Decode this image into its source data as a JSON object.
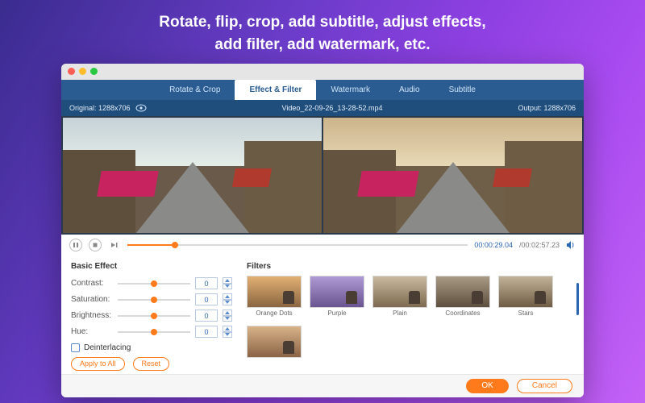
{
  "headline_line1": "Rotate, flip, crop, add subtitle, adjust effects,",
  "headline_line2": "add filter, add watermark, etc.",
  "tabs": {
    "rotate": "Rotate & Crop",
    "effect": "Effect & Filter",
    "watermark": "Watermark",
    "audio": "Audio",
    "subtitle": "Subtitle"
  },
  "infobar": {
    "original_label": "Original: 1288x706",
    "filename": "Video_22-09-26_13-28-52.mp4",
    "output_label": "Output: 1288x706"
  },
  "playback": {
    "current": "00:00:29.04",
    "total": "/00:02:57.23"
  },
  "basic": {
    "title": "Basic Effect",
    "contrast_label": "Contrast:",
    "saturation_label": "Saturation:",
    "brightness_label": "Brightness:",
    "hue_label": "Hue:",
    "contrast_value": "0",
    "saturation_value": "0",
    "brightness_value": "0",
    "hue_value": "0",
    "deinterlacing": "Deinterlacing",
    "apply_all": "Apply to All",
    "reset": "Reset"
  },
  "filters": {
    "title": "Filters",
    "items": [
      "Orange Dots",
      "Purple",
      "Plain",
      "Coordinates",
      "Stars",
      ""
    ]
  },
  "footer": {
    "ok": "OK",
    "cancel": "Cancel"
  }
}
